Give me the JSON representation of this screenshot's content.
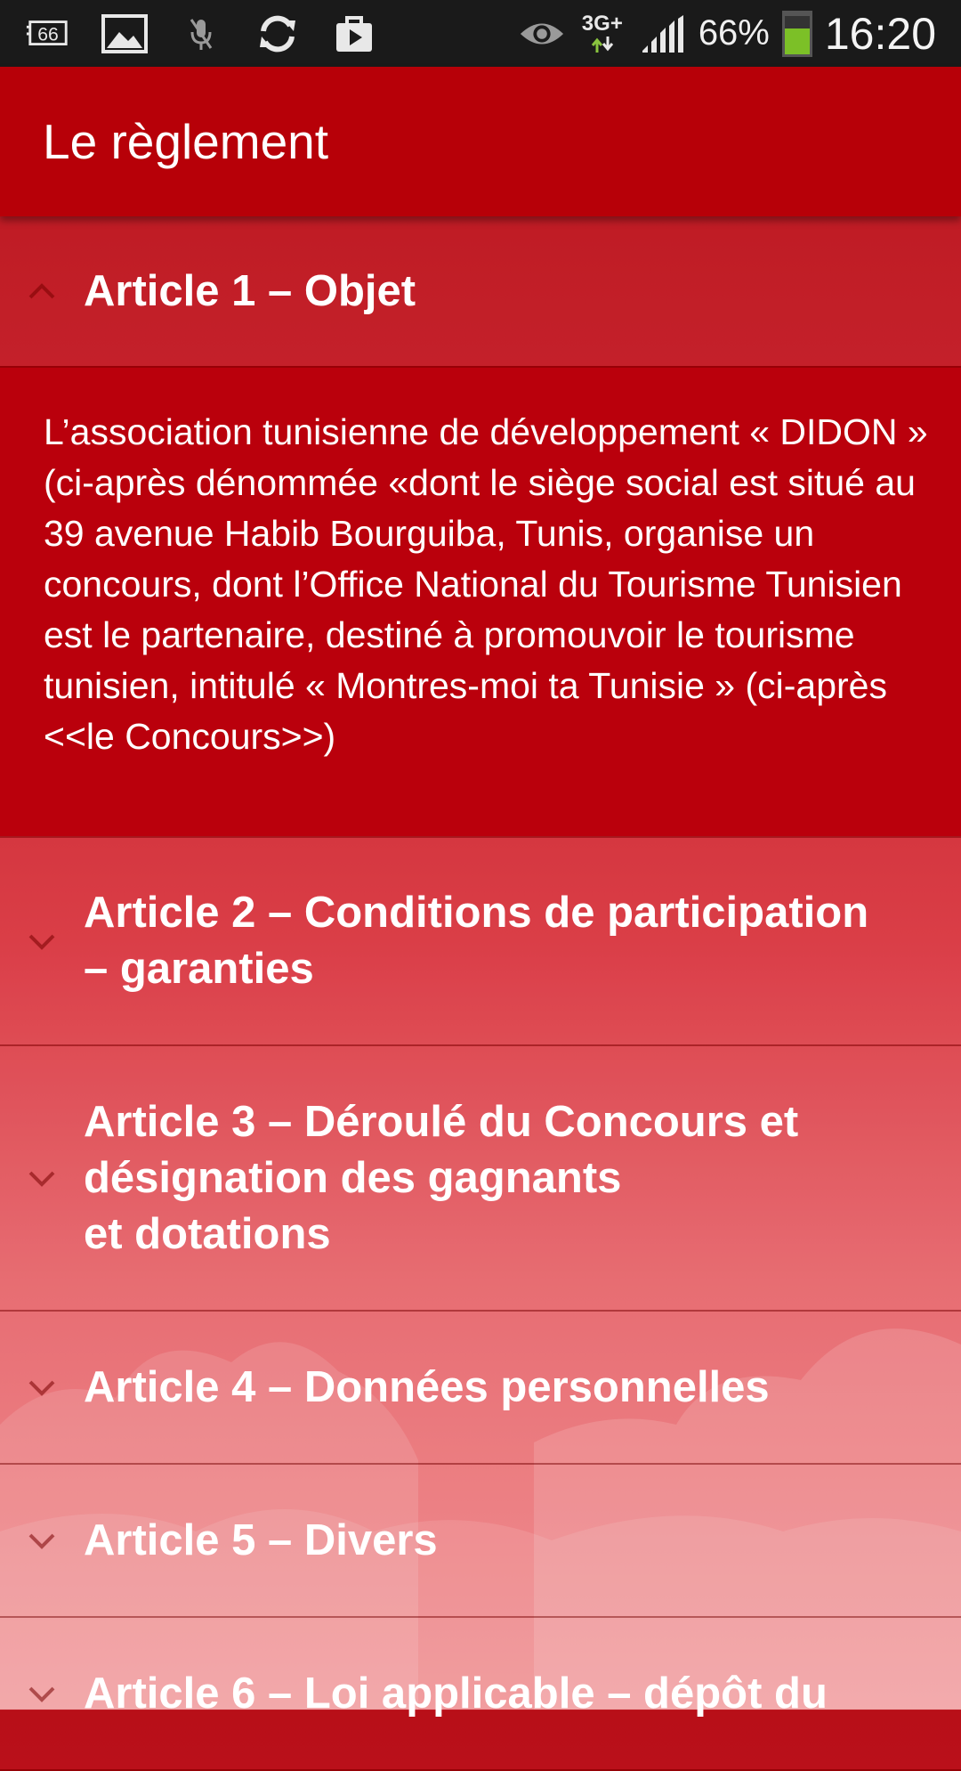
{
  "status_bar": {
    "notification_badge": "66",
    "network_type": "3G+",
    "battery_percent": "66%",
    "battery_level": 0.66,
    "time": "16:20",
    "icons": [
      "notification-66-icon",
      "image-icon",
      "mic-muted-icon",
      "sync-icon",
      "play-store-icon",
      "eye-icon",
      "network-arrows-icon",
      "signal-icon",
      "battery-icon"
    ]
  },
  "app_bar": {
    "title": "Le règlement"
  },
  "accordion": {
    "items": [
      {
        "title": "Article 1 – Objet",
        "expanded": true,
        "body": "L’association tunisienne de développement « DIDON » (ci-après dénommée «dont le siège social est situé au 39 avenue Habib Bourguiba, Tunis, organise un concours, dont l’Office National du Tourisme Tunisien est le partenaire, destiné à promouvoir le tourisme tunisien, intitulé « Montres-moi ta Tunisie » (ci-après <<le Concours>>)"
      },
      {
        "title": "Article 2 – Conditions de participation\n– garanties",
        "expanded": false
      },
      {
        "title": "Article 3 – Déroulé du Concours et\ndésignation des gagnants\n et dotations",
        "expanded": false
      },
      {
        "title": "Article 4 – Données personnelles",
        "expanded": false
      },
      {
        "title": "Article 5 – Divers",
        "expanded": false
      },
      {
        "title": "Article 6 – Loi applicable – dépôt du",
        "expanded": false
      }
    ]
  },
  "colors": {
    "app_bar": "#b70008",
    "status_bar": "#1a1a1a",
    "expanded_body": "#ba000c"
  }
}
